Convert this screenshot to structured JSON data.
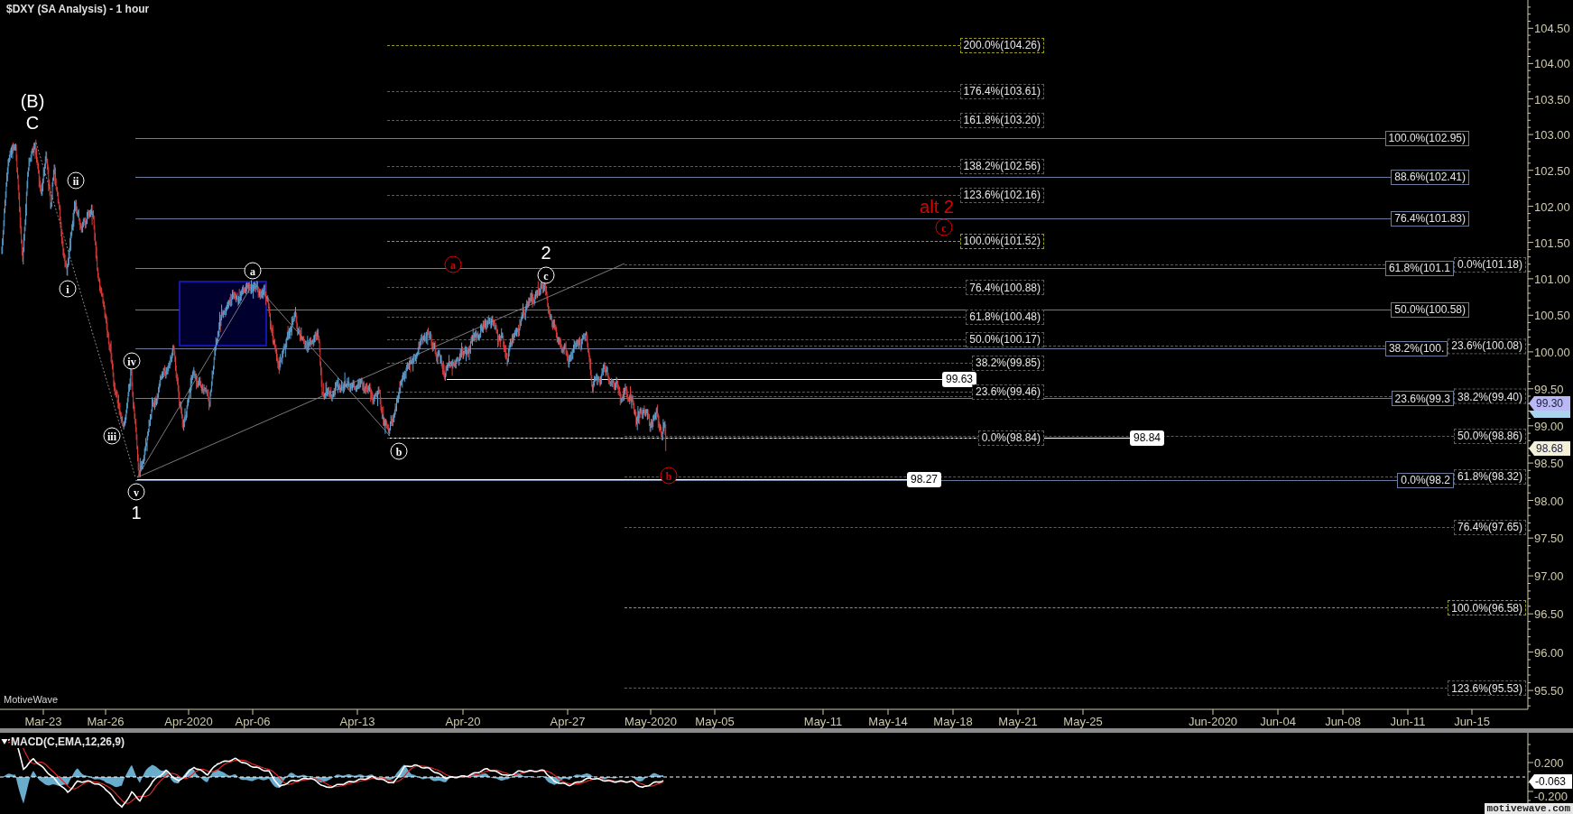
{
  "chart_title": "$DXY (SA Analysis) - 1 hour",
  "price_pane": {
    "brand_label": "MotiveWave",
    "price_axis": [
      "104.50",
      "104.00",
      "103.50",
      "103.00",
      "102.50",
      "102.00",
      "101.50",
      "101.00",
      "100.50",
      "100.00",
      "99.50",
      "99.00",
      "98.50",
      "98.00",
      "97.50",
      "97.00",
      "96.50",
      "96.00",
      "95.50"
    ],
    "time_axis": [
      "Mar-23",
      "Mar-26",
      "Apr-2020",
      "Apr-06",
      "Apr-13",
      "Apr-20",
      "Apr-27",
      "May-2020",
      "May-05",
      "May-11",
      "May-14",
      "May-18",
      "May-21",
      "May-25",
      "Jun-2020",
      "Jun-04",
      "Jun-08",
      "Jun-11",
      "Jun-15"
    ],
    "fib_sets": [
      {
        "kind": "dashed",
        "levels": [
          {
            "label": "200.0%(104.26)",
            "color": "#9a9a1e"
          },
          {
            "label": "176.4%(103.61)",
            "color": "#5c5c5c"
          },
          {
            "label": "161.8%(103.20)",
            "color": "#5c5c5c"
          },
          {
            "label": "138.2%(102.56)",
            "color": "#5c5c5c"
          },
          {
            "label": "123.6%(102.16)",
            "color": "#5c5c5c"
          },
          {
            "label": "100.0%(101.52)",
            "color": "#9a9a1e"
          },
          {
            "label": "76.4%(100.88)",
            "color": "#5c5c5c"
          },
          {
            "label": "61.8%(100.48)",
            "color": "#5c5c5c"
          },
          {
            "label": "50.0%(100.17)",
            "color": "#5c5c5c"
          },
          {
            "label": "38.2%(99.85)",
            "color": "#5c5c5c"
          },
          {
            "label": "23.6%(99.46)",
            "color": "#5c5c5c"
          },
          {
            "label": "0.0%(98.84)",
            "color": "#5c5c5c"
          }
        ]
      },
      {
        "kind": "solid",
        "levels": [
          {
            "label": "100.0%(102.95)"
          },
          {
            "label": "88.6%(102.41)"
          },
          {
            "label": "76.4%(101.83)"
          },
          {
            "label": "61.8%(101.1"
          },
          {
            "label": "50.0%(100.58)"
          },
          {
            "label": "38.2%(100."
          },
          {
            "label": "23.6%(99.3"
          },
          {
            "label": "0.0%(98.2"
          }
        ]
      },
      {
        "kind": "dashed",
        "levels": [
          {
            "label": "0.0%(101.18)",
            "color": "#5c5c5c"
          },
          {
            "label": "23.6%(100.08)",
            "color": "#5c5c5c"
          },
          {
            "label": "38.2%(99.40)",
            "color": "#5c5c5c"
          },
          {
            "label": "50.0%(98.86)",
            "color": "#5c5c5c"
          },
          {
            "label": "61.8%(98.32)",
            "color": "#5c5c5c"
          },
          {
            "label": "76.4%(97.65)",
            "color": "#5c5c5c"
          },
          {
            "label": "100.0%(96.58)",
            "color": "#9a9a1e"
          },
          {
            "label": "123.6%(95.53)",
            "color": "#5c5c5c"
          }
        ]
      }
    ],
    "price_lines": [
      {
        "label": "99.63"
      },
      {
        "label": "98.84"
      },
      {
        "label": "98.27"
      }
    ],
    "wave_labels": [
      {
        "text": "(B)",
        "kind": "plain",
        "color": "#ffffff"
      },
      {
        "text": "C",
        "kind": "plain",
        "color": "#ffffff"
      },
      {
        "text": "i",
        "kind": "circled",
        "color": "#ffffff"
      },
      {
        "text": "ii",
        "kind": "circled",
        "color": "#ffffff"
      },
      {
        "text": "iii",
        "kind": "circled",
        "color": "#ffffff"
      },
      {
        "text": "iv",
        "kind": "circled",
        "color": "#ffffff"
      },
      {
        "text": "v",
        "kind": "circled",
        "color": "#ffffff"
      },
      {
        "text": "1",
        "kind": "plain",
        "color": "#ffffff"
      },
      {
        "text": "a",
        "kind": "circled",
        "color": "#ffffff"
      },
      {
        "text": "b",
        "kind": "circled",
        "color": "#ffffff"
      },
      {
        "text": "c",
        "kind": "circled",
        "color": "#ffffff"
      },
      {
        "text": "2",
        "kind": "plain",
        "color": "#ffffff"
      },
      {
        "text": "a",
        "kind": "circled",
        "color": "#e00000"
      },
      {
        "text": "b",
        "kind": "circled",
        "color": "#e00000"
      },
      {
        "text": "c",
        "kind": "circled",
        "color": "#e00000"
      },
      {
        "text": "alt 2",
        "kind": "plain",
        "color": "#e00000"
      }
    ],
    "axis_tags": [
      {
        "label": "99.30",
        "color": "#b9b9f5"
      },
      {
        "label": "98.68",
        "color": "#f3f0d8"
      }
    ]
  },
  "macd_pane": {
    "title": "MACD(C,EMA,12,26,9)",
    "axis": [
      "0.200",
      "-0.200"
    ],
    "value_tag": "-0.063"
  },
  "footer_badge": "motivewave.com"
}
